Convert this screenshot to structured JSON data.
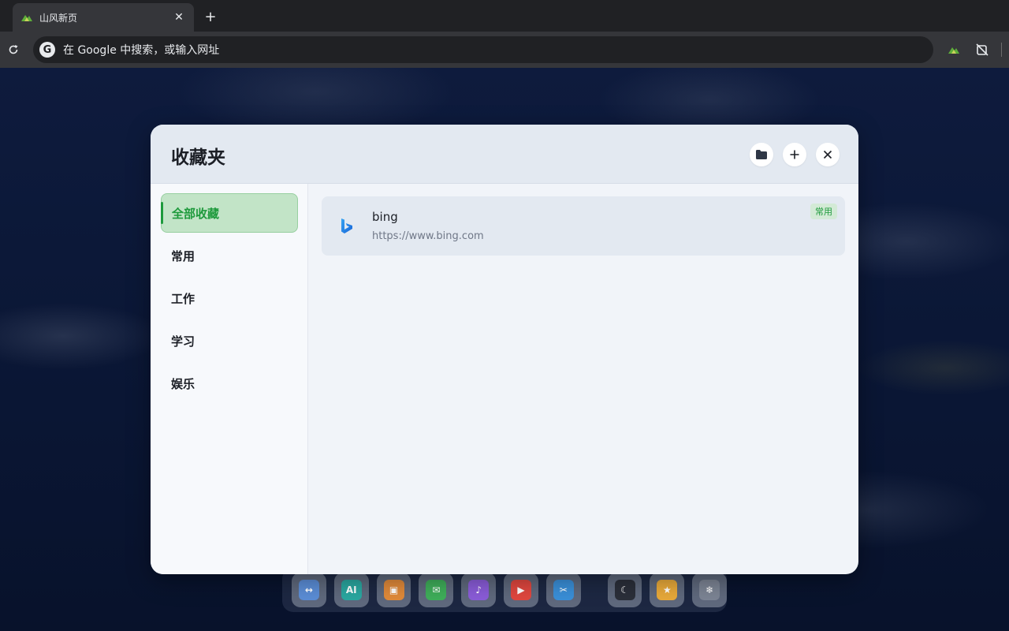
{
  "browser": {
    "tab_title": "山风新页",
    "omnibox_placeholder": "在 Google 中搜索，或输入网址",
    "g_letter": "G"
  },
  "modal": {
    "title": "收藏夹",
    "buttons": {
      "folder": "folder-icon",
      "add": "plus-icon",
      "close": "close-icon"
    }
  },
  "categories": [
    "全部收藏",
    "常用",
    "工作",
    "学习",
    "娱乐"
  ],
  "active_category": "全部收藏",
  "bookmarks": [
    {
      "name": "bing",
      "url": "https://www.bing.com",
      "tag": "常用"
    }
  ],
  "dock": {
    "apps": [
      "translate",
      "AI",
      "image",
      "mail",
      "music",
      "video",
      "tools",
      "night-mode",
      "star",
      "settings"
    ],
    "ai_label": "AI"
  },
  "colors": {
    "accent": "#1e9a3c",
    "active_bg": "#c2e4c7",
    "tag_bg": "#d3ead6"
  }
}
